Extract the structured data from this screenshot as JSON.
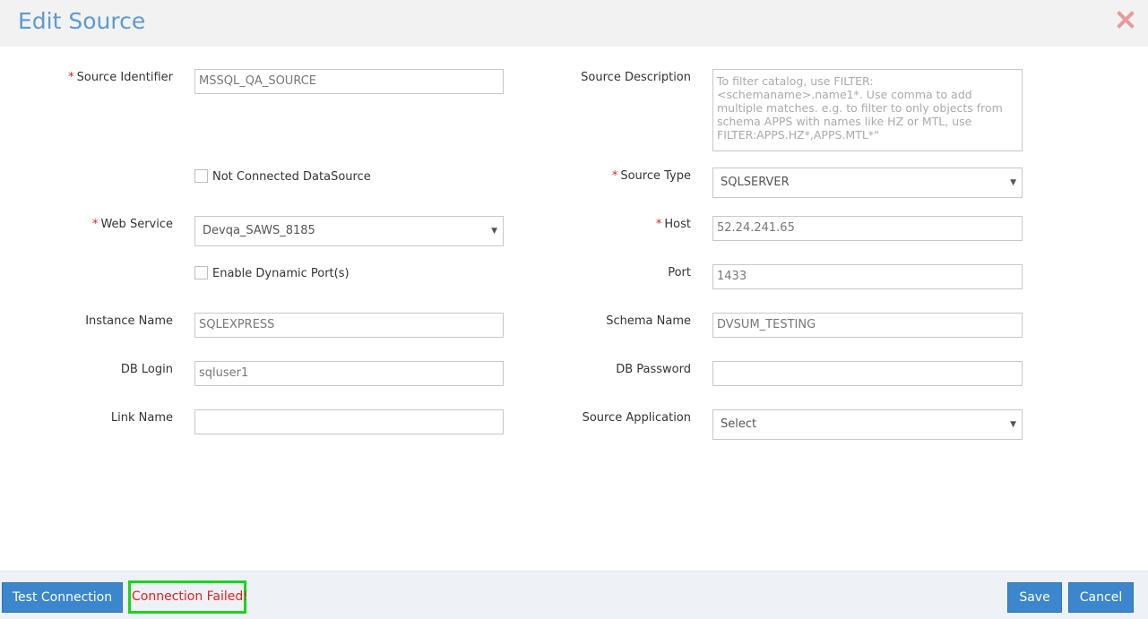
{
  "dialog": {
    "title": "Edit Source"
  },
  "form": {
    "source_identifier": {
      "label": "Source Identifier",
      "value": "MSSQL_QA_SOURCE"
    },
    "source_description": {
      "label": "Source Description",
      "placeholder": "To filter catalog, use FILTER:<schemaname>.name1*. Use comma to add multiple matches. e.g. to filter to only objects from schema APPS with names like HZ or MTL, use FILTER:APPS.HZ*,APPS.MTL*\""
    },
    "not_connected": {
      "label": "Not Connected DataSource"
    },
    "source_type": {
      "label": "Source Type",
      "value": "SQLSERVER"
    },
    "web_service": {
      "label": "Web Service",
      "value": "Devqa_SAWS_8185"
    },
    "host": {
      "label": "Host",
      "value": "52.24.241.65"
    },
    "dynamic_port": {
      "label": "Enable Dynamic Port(s)"
    },
    "port": {
      "label": "Port",
      "value": "1433"
    },
    "instance_name": {
      "label": "Instance Name",
      "value": "SQLEXPRESS"
    },
    "schema_name": {
      "label": "Schema Name",
      "value": "DVSUM_TESTING"
    },
    "db_login": {
      "label": "DB Login",
      "value": "sqluser1"
    },
    "db_password": {
      "label": "DB Password",
      "value": ""
    },
    "link_name": {
      "label": "Link Name",
      "value": ""
    },
    "source_application": {
      "label": "Source Application",
      "value": "Select"
    }
  },
  "footer": {
    "test_connection": "Test Connection",
    "status": "Connection Failed!",
    "save": "Save",
    "cancel": "Cancel"
  },
  "colors": {
    "primary": "#3b86cc",
    "title": "#5b9bd1",
    "error": "#e02222",
    "highlight": "#19d619"
  }
}
